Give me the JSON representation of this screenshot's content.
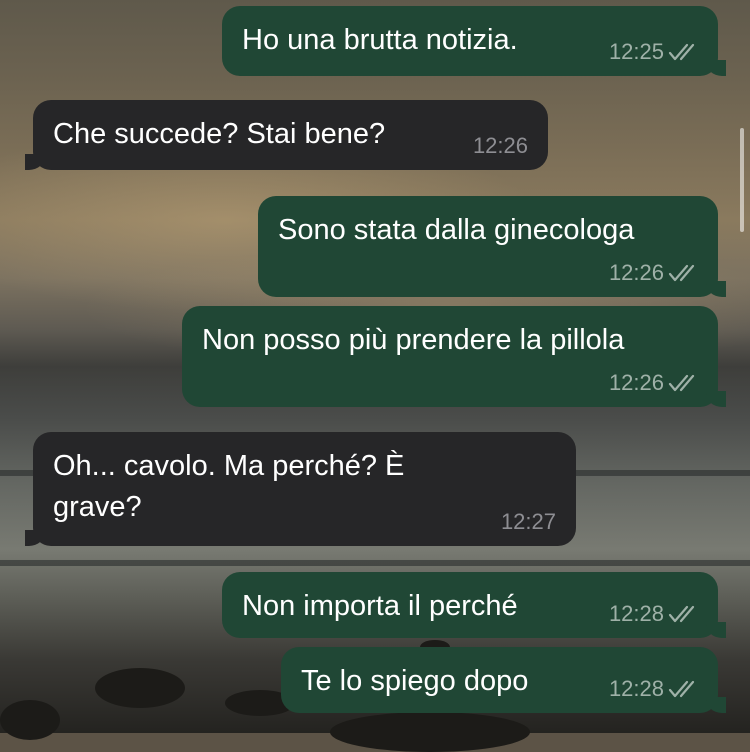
{
  "chat": {
    "messages": [
      {
        "direction": "outgoing",
        "text": "Ho una brutta notizia.",
        "time": "12:25",
        "status_icon": "double-check-icon"
      },
      {
        "direction": "incoming",
        "text": "Che succede? Stai bene?",
        "time": "12:26"
      },
      {
        "direction": "outgoing",
        "text": "Sono stata dalla ginecologa",
        "time": "12:26",
        "status_icon": "double-check-icon"
      },
      {
        "direction": "outgoing",
        "text": "Non posso più prendere la pillola",
        "time": "12:26",
        "status_icon": "double-check-icon"
      },
      {
        "direction": "incoming",
        "text": "Oh... cavolo. Ma perché? È grave?",
        "time": "12:27"
      },
      {
        "direction": "outgoing",
        "text": "Non importa il perché",
        "time": "12:28",
        "status_icon": "double-check-icon"
      },
      {
        "direction": "outgoing",
        "text": "Te lo spiego dopo",
        "time": "12:28",
        "status_icon": "double-check-icon"
      }
    ]
  },
  "colors": {
    "outgoing_bubble": "#204735",
    "incoming_bubble": "#262628",
    "text": "#ffffff",
    "outgoing_meta": "#9fb1a8",
    "incoming_meta": "#8e8e93"
  }
}
